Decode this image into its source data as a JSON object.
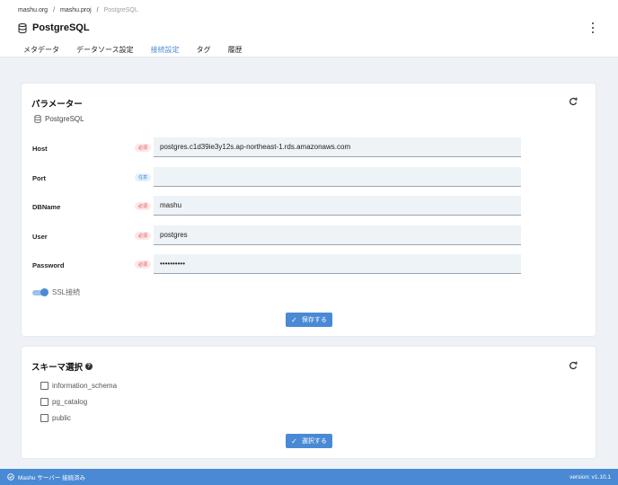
{
  "breadcrumb": [
    "mashu.org",
    "mashu.proj",
    "PostgreSQL"
  ],
  "breadcrumb_separator": "/",
  "header": {
    "title": "PostgreSQL"
  },
  "tabs": [
    {
      "label": "メタデータ",
      "active": false
    },
    {
      "label": "データソース設定",
      "active": false
    },
    {
      "label": "接続設定",
      "active": true
    },
    {
      "label": "タグ",
      "active": false
    },
    {
      "label": "履歴",
      "active": false
    }
  ],
  "params": {
    "title": "パラメーター",
    "db_type": "PostgreSQL",
    "fields": [
      {
        "label": "Host",
        "badge": "必須",
        "required": true,
        "value": "postgres.c1d39ie3y12s.ap-northeast-1.rds.amazonaws.com"
      },
      {
        "label": "Port",
        "badge": "任意",
        "required": false,
        "value": ""
      },
      {
        "label": "DBName",
        "badge": "必須",
        "required": true,
        "value": "mashu"
      },
      {
        "label": "User",
        "badge": "必須",
        "required": true,
        "value": "postgres"
      },
      {
        "label": "Password",
        "badge": "必須",
        "required": true,
        "value": "••••••••••"
      }
    ],
    "ssl_label": "SSL接続",
    "ssl_enabled": true,
    "save_label": "保存する"
  },
  "schema": {
    "title": "スキーマ選択",
    "help": "?",
    "options": [
      {
        "label": "information_schema",
        "checked": false
      },
      {
        "label": "pg_catalog",
        "checked": false
      },
      {
        "label": "public",
        "checked": false
      }
    ],
    "select_label": "選択する"
  },
  "status": {
    "left": "Mashu サーバー 接続済み",
    "right": "version: v1.10.1"
  },
  "colors": {
    "accent": "#4a8ad4",
    "required_badge": "#fde7e7",
    "optional_badge": "#e4f0fb",
    "background": "#eef2f7"
  }
}
